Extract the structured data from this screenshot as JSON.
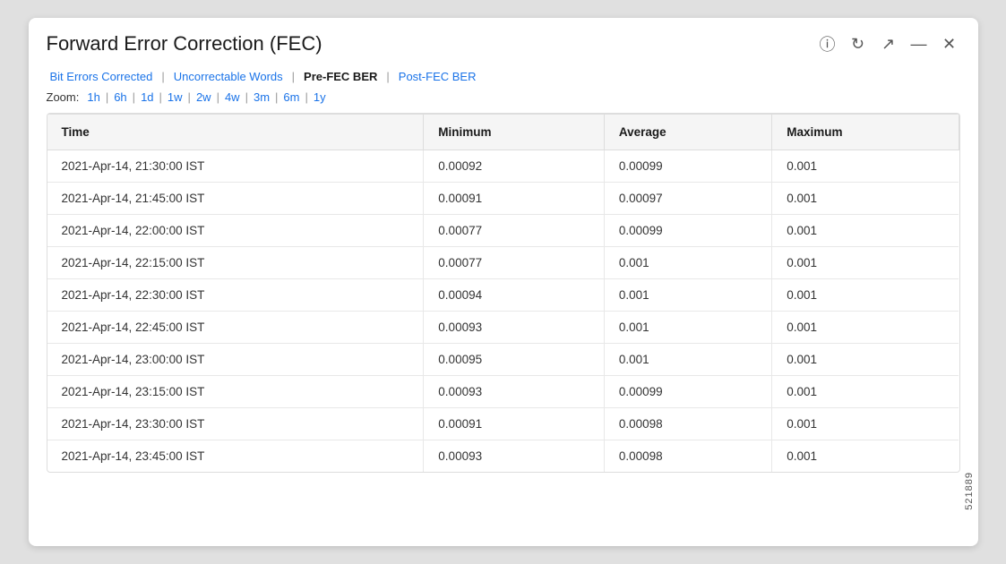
{
  "card": {
    "title": "Forward Error Correction (FEC)"
  },
  "header_icons": [
    {
      "name": "help-icon",
      "symbol": "?"
    },
    {
      "name": "refresh-icon",
      "symbol": "↻"
    },
    {
      "name": "external-link-icon",
      "symbol": "↗"
    },
    {
      "name": "minimize-icon",
      "symbol": "—"
    },
    {
      "name": "close-icon",
      "symbol": "✕"
    }
  ],
  "nav_tabs": [
    {
      "label": "Bit Errors Corrected",
      "active": false
    },
    {
      "label": "Uncorrectable Words",
      "active": false
    },
    {
      "label": "Pre-FEC BER",
      "active": true
    },
    {
      "label": "Post-FEC BER",
      "active": false
    }
  ],
  "zoom": {
    "label": "Zoom:",
    "options": [
      "1h",
      "6h",
      "1d",
      "1w",
      "2w",
      "4w",
      "3m",
      "6m",
      "1y"
    ]
  },
  "table": {
    "columns": [
      "Time",
      "Minimum",
      "Average",
      "Maximum"
    ],
    "rows": [
      {
        "time": "2021-Apr-14, 21:30:00 IST",
        "min": "0.00092",
        "avg": "0.00099",
        "max": "0.001"
      },
      {
        "time": "2021-Apr-14, 21:45:00 IST",
        "min": "0.00091",
        "avg": "0.00097",
        "max": "0.001"
      },
      {
        "time": "2021-Apr-14, 22:00:00 IST",
        "min": "0.00077",
        "avg": "0.00099",
        "max": "0.001"
      },
      {
        "time": "2021-Apr-14, 22:15:00 IST",
        "min": "0.00077",
        "avg": "0.001",
        "max": "0.001"
      },
      {
        "time": "2021-Apr-14, 22:30:00 IST",
        "min": "0.00094",
        "avg": "0.001",
        "max": "0.001"
      },
      {
        "time": "2021-Apr-14, 22:45:00 IST",
        "min": "0.00093",
        "avg": "0.001",
        "max": "0.001"
      },
      {
        "time": "2021-Apr-14, 23:00:00 IST",
        "min": "0.00095",
        "avg": "0.001",
        "max": "0.001"
      },
      {
        "time": "2021-Apr-14, 23:15:00 IST",
        "min": "0.00093",
        "avg": "0.00099",
        "max": "0.001"
      },
      {
        "time": "2021-Apr-14, 23:30:00 IST",
        "min": "0.00091",
        "avg": "0.00098",
        "max": "0.001"
      },
      {
        "time": "2021-Apr-14, 23:45:00 IST",
        "min": "0.00093",
        "avg": "0.00098",
        "max": "0.001"
      }
    ]
  },
  "side_label": "521889"
}
